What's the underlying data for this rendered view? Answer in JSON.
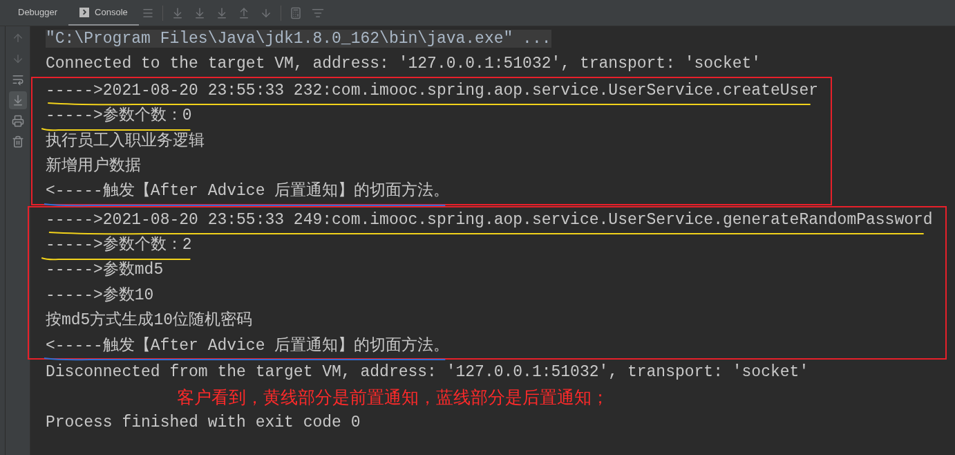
{
  "tool_window": {
    "tabs": [
      {
        "label": "Debugger",
        "selected": false
      },
      {
        "label": "Console",
        "selected": true
      }
    ]
  },
  "console": {
    "blocks": [
      {
        "kind": "plain",
        "lines": [
          {
            "kind": "command",
            "text": "\"C:\\Program Files\\Java\\jdk1.8.0_162\\bin\\java.exe\" ..."
          },
          {
            "kind": "output",
            "text": "Connected to the target VM, address: '127.0.0.1:51032', transport: 'socket'"
          }
        ]
      },
      {
        "kind": "boxed",
        "lines": [
          {
            "kind": "output",
            "text": "----->2021-08-20 23:55:33 232:com.imooc.spring.aop.service.UserService.createUser",
            "color": "#f2d21b"
          },
          {
            "kind": "output",
            "text": "----->参数个数：0",
            "color": "#f2d21b"
          },
          {
            "kind": "output",
            "text": "执行员工入职业务逻辑"
          },
          {
            "kind": "output",
            "text": "新增用户数据"
          },
          {
            "kind": "output",
            "text": "<-----触发【After Advice 后置通知】的切面方法。",
            "color": "#2f6fd6"
          }
        ]
      },
      {
        "kind": "boxed",
        "lines": [
          {
            "kind": "output",
            "text": "----->2021-08-20 23:55:33 249:com.imooc.spring.aop.service.UserService.generateRandomPassword",
            "color": "#f2d21b"
          },
          {
            "kind": "output",
            "text": "----->参数个数：2",
            "color": "#f2d21b"
          },
          {
            "kind": "output",
            "text": "----->参数md5"
          },
          {
            "kind": "output",
            "text": "----->参数10"
          },
          {
            "kind": "output",
            "text": "按md5方式生成10位随机密码"
          },
          {
            "kind": "output",
            "text": "<-----触发【After Advice 后置通知】的切面方法。",
            "color": "#2f6fd6"
          }
        ]
      },
      {
        "kind": "plain",
        "lines": [
          {
            "kind": "output",
            "text": "Disconnected from the target VM, address: '127.0.0.1:51032', transport: 'socket'"
          },
          {
            "kind": "annotation",
            "text": "客户看到，黄线部分是前置通知，蓝线部分是后置通知；"
          },
          {
            "kind": "output",
            "text": "Process finished with exit code 0"
          }
        ]
      }
    ]
  }
}
